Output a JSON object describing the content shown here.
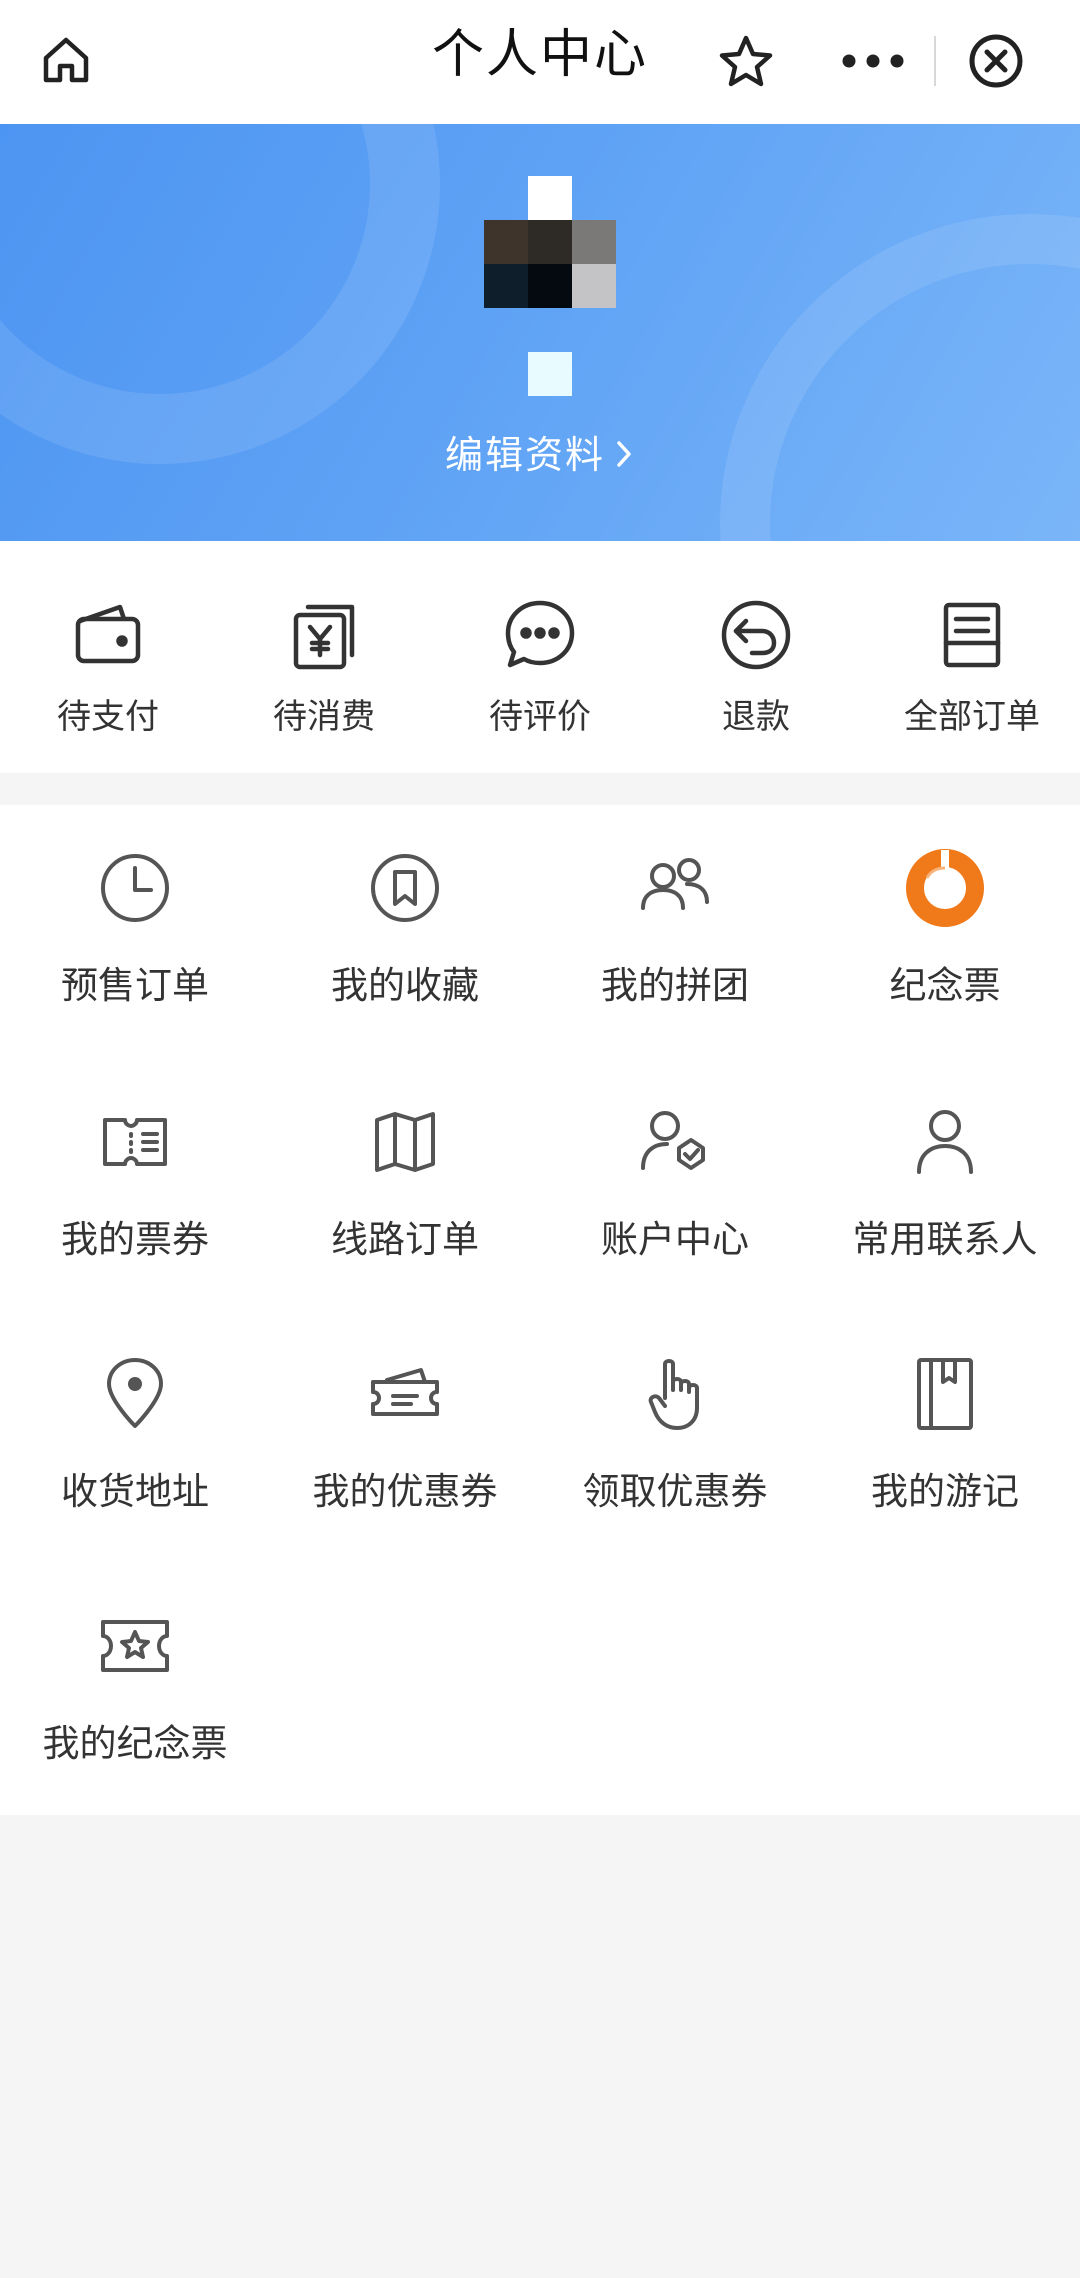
{
  "nav": {
    "title": "个人中心",
    "home_icon": "home-icon",
    "favorite_icon": "star-icon",
    "more_icon": "more-dots-icon",
    "close_icon": "close-circle-icon"
  },
  "profile": {
    "edit_label": "编辑资料",
    "hero_color": "#5ea2f5"
  },
  "orders": [
    {
      "label": "待支付",
      "icon": "wallet-icon"
    },
    {
      "label": "待消费",
      "icon": "voucher-yen-icon"
    },
    {
      "label": "待评价",
      "icon": "comment-icon"
    },
    {
      "label": "退款",
      "icon": "refund-icon"
    },
    {
      "label": "全部订单",
      "icon": "order-list-icon"
    }
  ],
  "features": [
    {
      "label": "预售订单",
      "icon": "clock-icon"
    },
    {
      "label": "我的收藏",
      "icon": "bookmark-icon"
    },
    {
      "label": "我的拼团",
      "icon": "group-icon"
    },
    {
      "label": "纪念票",
      "icon": "souvenir-ticket-icon"
    },
    {
      "label": "我的票券",
      "icon": "ticket-icon"
    },
    {
      "label": "线路订单",
      "icon": "map-icon"
    },
    {
      "label": "账户中心",
      "icon": "account-verified-icon"
    },
    {
      "label": "常用联系人",
      "icon": "contact-icon"
    },
    {
      "label": "收货地址",
      "icon": "location-pin-icon"
    },
    {
      "label": "我的优惠券",
      "icon": "coupon-icon"
    },
    {
      "label": "领取优惠券",
      "icon": "hand-pointer-icon"
    },
    {
      "label": "我的游记",
      "icon": "notebook-icon"
    },
    {
      "label": "我的纪念票",
      "icon": "star-ticket-icon"
    }
  ],
  "colors": {
    "accent_orange": "#f07a1a",
    "icon_gray": "#333333"
  }
}
